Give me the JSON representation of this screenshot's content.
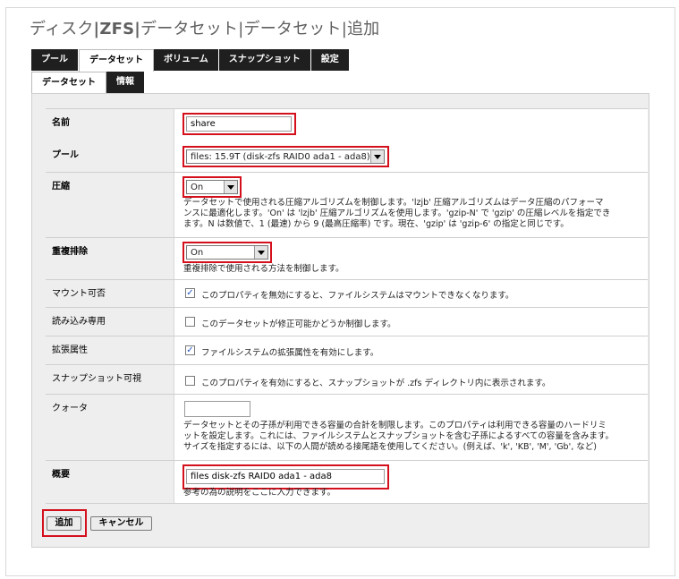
{
  "breadcrumb": {
    "part1": "ディスク",
    "sep1": "|",
    "part2": "ZFS",
    "sep2": "|",
    "part3": "データセット",
    "sep3": "|",
    "part4": "データセット",
    "sep4": "|",
    "part5": "追加"
  },
  "tabs": [
    "プール",
    "データセット",
    "ボリューム",
    "スナップショット",
    "設定"
  ],
  "subtabs": [
    "データセット",
    "情報"
  ],
  "form": {
    "name": {
      "label": "名前",
      "value": "share"
    },
    "pool": {
      "label": "プール",
      "selected": "files: 15.9T (disk-zfs RAID0 ada1 - ada8)"
    },
    "compression": {
      "label": "圧縮",
      "selected": "On",
      "desc1": "データセットで使用される圧縮アルゴリズムを制御します。'lzjb' 圧縮アルゴリズムはデータ圧縮のパフォーマ",
      "desc2": "ンスに最適化します。'On' は 'lzjb' 圧縮アルゴリズムを使用します。'gzip-N' で 'gzip' の圧縮レベルを指定でき",
      "desc3": "ます。N は数値で、1 (最速) から 9 (最高圧縮率) です。現在、'gzip' は 'gzip-6' の指定と同じです。"
    },
    "dedup": {
      "label": "重複排除",
      "selected": "On",
      "desc": "重複排除で使用される方法を制御します。"
    },
    "mountable": {
      "label": "マウント可否",
      "checked": true,
      "text": "このプロパティを無効にすると、ファイルシステムはマウントできなくなります。"
    },
    "readonly": {
      "label": "読み込み専用",
      "checked": false,
      "text": "このデータセットが修正可能かどうか制御します。"
    },
    "xattr": {
      "label": "拡張属性",
      "checked": true,
      "text": "ファイルシステムの拡張属性を有効にします。"
    },
    "snapdir": {
      "label": "スナップショット可視",
      "checked": false,
      "text": "このプロパティを有効にすると、スナップショットが .zfs ディレクトリ内に表示されます。"
    },
    "quota": {
      "label": "クォータ",
      "value": "",
      "desc1": "データセットとその子孫が利用できる容量の合計を制限します。このプロパティは利用できる容量のハードリミ",
      "desc2": "ットを設定します。これには、ファイルシステムとスナップショットを含む子孫によるすべての容量を含みます。",
      "desc3": "サイズを指定するには、以下の人間が読める接尾語を使用してください。(例えば、'k', 'KB', 'M', 'Gb', など)"
    },
    "description": {
      "label": "概要",
      "value": "files disk-zfs RAID0 ada1 - ada8",
      "desc": "参考の為の説明をここに入力できます。"
    }
  },
  "buttons": {
    "add": "追加",
    "cancel": "キャンセル"
  },
  "colors": {
    "highlight": "#d4101c",
    "tab_bg": "#1f1f1f",
    "panel_bg": "#eeeeee"
  }
}
